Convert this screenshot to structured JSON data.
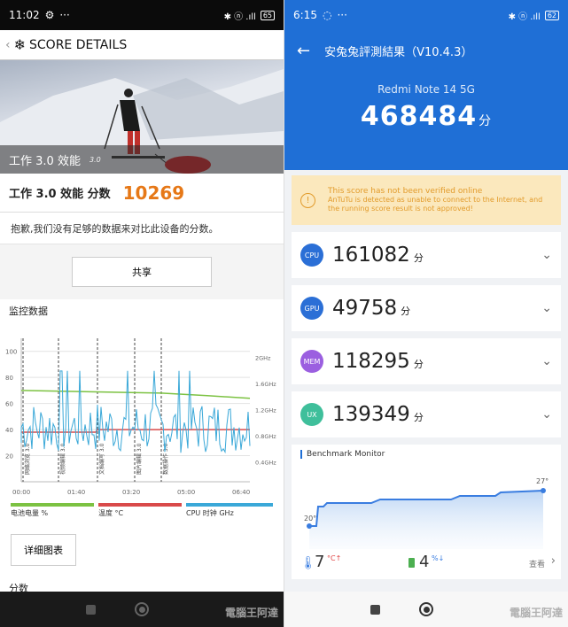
{
  "left": {
    "status": {
      "time": "11:02",
      "icons": "✱ ⓝ .ıll",
      "battery": "65"
    },
    "header": {
      "title": "SCORE DETAILS"
    },
    "hero": {
      "title": "工作 3.0 效能",
      "version": "3.0"
    },
    "score": {
      "label": "工作 3.0 效能 分数",
      "value": "10269"
    },
    "note": "抱歉,我们没有足够的数据来对比此设备的分数。",
    "share_label": "共享",
    "monitor_title": "监控数据",
    "chart": {
      "y_left_ticks": [
        "100",
        "80",
        "60",
        "40",
        "20"
      ],
      "y_right_ticks": [
        "2GHz",
        "1.6GHz",
        "1.2GHz",
        "0.8GHz",
        "0.4GHz"
      ],
      "x_ticks": [
        "00:00",
        "01:40",
        "03:20",
        "05:00",
        "06:40"
      ],
      "markers": [
        "网络浏览 3.0",
        "视频编辑 3.0",
        "文档编写 3.0",
        "图片编辑 3.0",
        "数据操作 3.0"
      ],
      "colors": {
        "battery": "#7cc242",
        "temp": "#d94a4a",
        "cpu": "#3aa8d8"
      }
    },
    "legend": {
      "battery": "电池电量 %",
      "temp": "温度 °C",
      "cpu": "CPU 时钟 GHz"
    },
    "detail_label": "详细图表",
    "scores_label": "分数"
  },
  "right": {
    "status": {
      "time": "6:15",
      "icons": "✱ ⓝ .ıll",
      "battery": "62"
    },
    "toolbar_title": "安兔兔評測結果（V10.4.3）",
    "device": "Redmi Note 14 5G",
    "total": "468484",
    "unit": "分",
    "warning": {
      "title": "This score has not been verified online",
      "body": "AnTuTu is detected as unable to connect to the Internet, and the running score result is not approved!"
    },
    "cards": [
      {
        "chip": "CPU",
        "value": "161082",
        "color": "#2b6fd6"
      },
      {
        "chip": "GPU",
        "value": "49758",
        "color": "#2b6fd6"
      },
      {
        "chip": "MEM",
        "value": "118295",
        "color": "#9b5fe0"
      },
      {
        "chip": "UX",
        "value": "139349",
        "color": "#3fbf9b"
      }
    ],
    "benchmark": {
      "title": "Benchmark Monitor",
      "start_temp": "20°",
      "end_temp": "27°",
      "temp_value": "7",
      "temp_unit": "°C↑",
      "batt_value": "4",
      "batt_unit": "%↓",
      "more": "查看"
    }
  }
}
